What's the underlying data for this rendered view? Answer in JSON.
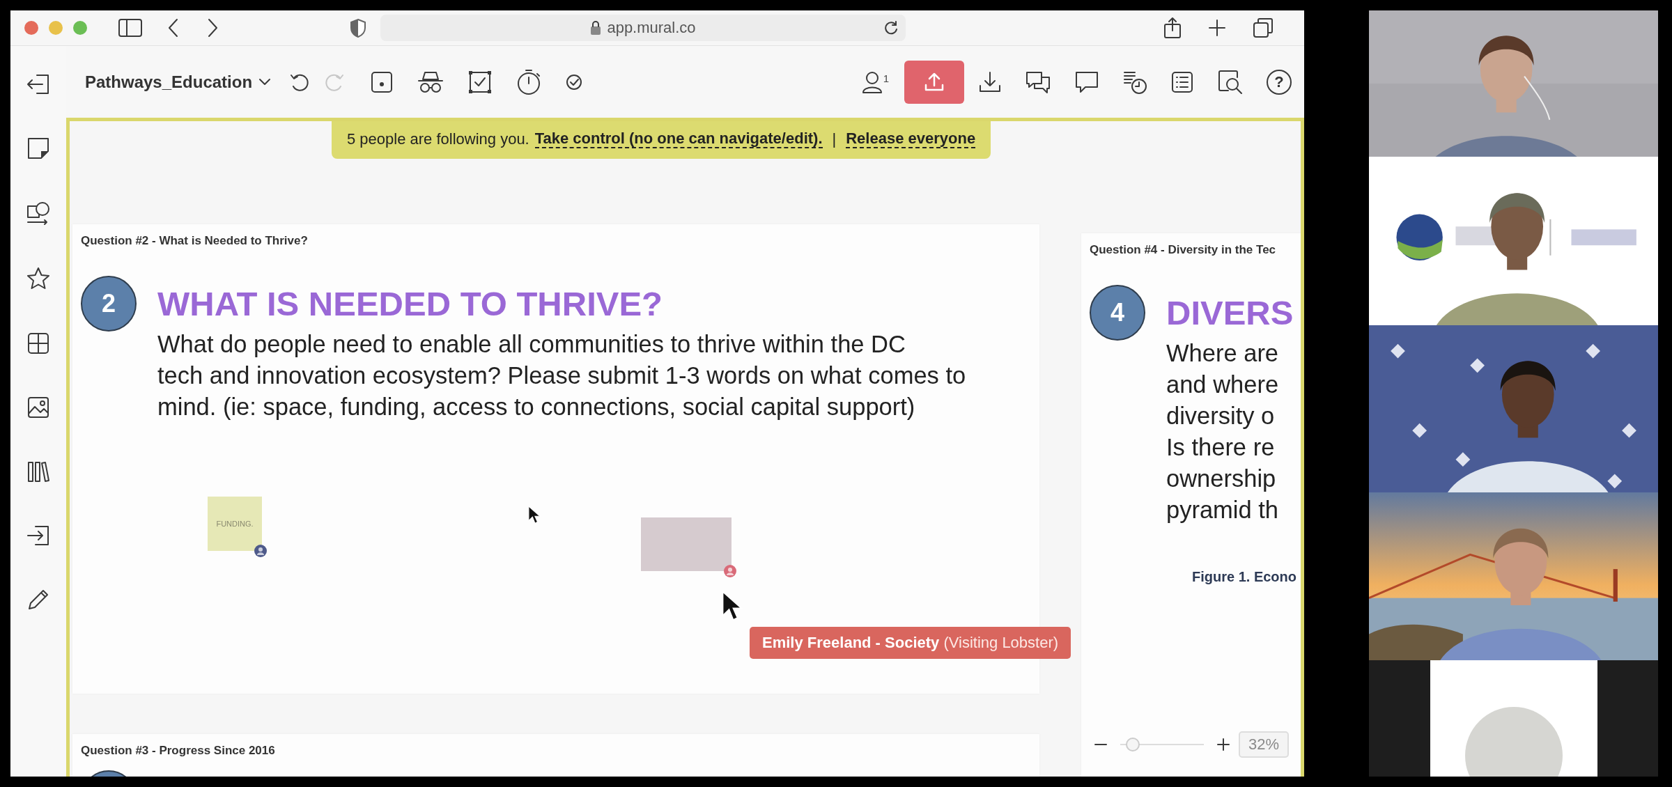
{
  "browser": {
    "url": "app.mural.co"
  },
  "toolbar": {
    "title": "Pathways_Education",
    "redo": {
      "disabled": true
    },
    "collaborators_count": "1",
    "help": "?"
  },
  "follow_banner": {
    "text": "5 people are following you.",
    "take_control": "Take control (no one can navigate/edit).",
    "separator": "|",
    "release": "Release everyone"
  },
  "frames": [
    {
      "label": "Question #2 - What is Needed to Thrive?",
      "number": "2",
      "title": "WHAT IS NEEDED TO THRIVE?",
      "body": "What do people need to enable all communities to thrive within the DC\ntech and innovation ecosystem? Please submit 1-3 words on what comes to\nmind. (ie: space, funding, access to connections, social capital support)",
      "stickies": [
        {
          "text": "FUNDING.",
          "color": "#e6e8b6"
        },
        {
          "color": "#d6cbcf"
        }
      ]
    },
    {
      "label": "Question #4 - Diversity in the Tec",
      "number": "4",
      "title": "DIVERS",
      "body": "Where are\nand where\ndiversity o\nIs there re\nownership\npyramid th",
      "caption": "Figure 1. Econo"
    },
    {
      "label": "Question #3 - Progress Since 2016"
    }
  ],
  "cursor_label": "**Emily Freeland - Society** (Visiting Lobster)",
  "zoom": {
    "level": 0.15,
    "value": "32%"
  },
  "video_tiles": [
    {
      "kind": "picture"
    },
    {
      "kind": "picture"
    },
    {
      "kind": "picture"
    },
    {
      "kind": "picture"
    },
    {
      "kind": "avatar"
    }
  ]
}
